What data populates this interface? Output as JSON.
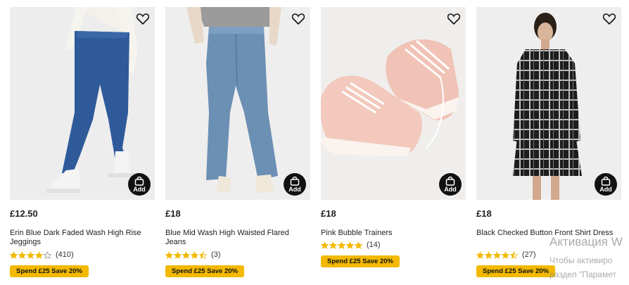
{
  "colors": {
    "promo_bg": "#f2b900",
    "star": "#f2b900",
    "add_button": "#111111"
  },
  "products": [
    {
      "price": "£12.50",
      "title": "Erin Blue Dark Faded Wash High Rise Jeggings",
      "rating": 4,
      "rating_count": "(410)",
      "promo": "Spend £25 Save 20%",
      "add_label": "Add",
      "image": "blue-jeggings-photo"
    },
    {
      "price": "£18",
      "title": "Blue Mid Wash High Waisted Flared Jeans",
      "rating": 4.5,
      "rating_count": "(3)",
      "promo": "Spend £25 Save 20%",
      "add_label": "Add",
      "image": "flared-jeans-photo"
    },
    {
      "price": "£18",
      "title": "Pink Bubble Trainers",
      "rating": 5,
      "rating_count": "(14)",
      "promo": "Spend £25 Save 20%",
      "add_label": "Add",
      "image": "pink-trainers-photo"
    },
    {
      "price": "£18",
      "title": "Black Checked Button Front Shirt Dress",
      "rating": 4.5,
      "rating_count": "(27)",
      "promo": "Spend £25 Save 20%",
      "add_label": "Add",
      "image": "checked-dress-photo"
    }
  ],
  "watermark": {
    "title": "Активация W",
    "line1": "Чтобы активиро",
    "line2": "раздел \"Парамет"
  }
}
